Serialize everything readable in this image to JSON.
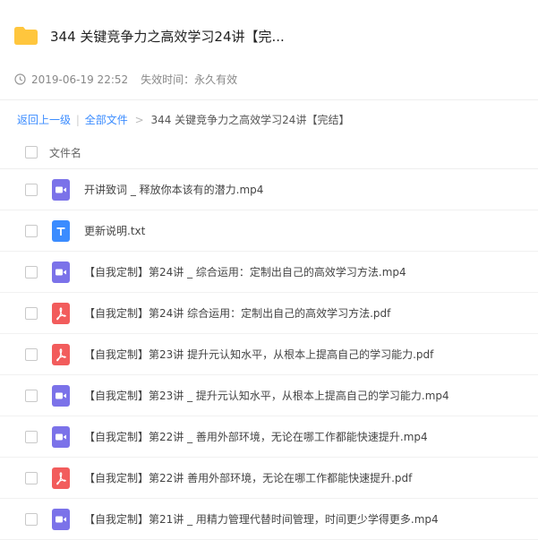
{
  "header": {
    "title": "344 关键竞争力之高效学习24讲【完...",
    "date": "2019-06-19 22:52",
    "expiry": "失效时间：永久有效"
  },
  "breadcrumb": {
    "back": "返回上一级",
    "divider": "|",
    "all": "全部文件",
    "arrow": ">",
    "current": "344 关键竞争力之高效学习24讲【完结】"
  },
  "list": {
    "header_label": "文件名",
    "files": [
      {
        "name": "开讲致词 _ 释放你本该有的潜力.mp4",
        "icon": "video-icon"
      },
      {
        "name": "更新说明.txt",
        "icon": "text-icon"
      },
      {
        "name": "【自我定制】第24讲 _ 综合运用：定制出自己的高效学习方法.mp4",
        "icon": "video-icon"
      },
      {
        "name": "【自我定制】第24讲 综合运用：定制出自己的高效学习方法.pdf",
        "icon": "pdf-icon"
      },
      {
        "name": "【自我定制】第23讲 提升元认知水平，从根本上提高自己的学习能力.pdf",
        "icon": "pdf-icon"
      },
      {
        "name": "【自我定制】第23讲 _ 提升元认知水平，从根本上提高自己的学习能力.mp4",
        "icon": "video-icon"
      },
      {
        "name": "【自我定制】第22讲 _ 善用外部环境，无论在哪工作都能快速提升.mp4",
        "icon": "video-icon"
      },
      {
        "name": "【自我定制】第22讲 善用外部环境，无论在哪工作都能快速提升.pdf",
        "icon": "pdf-icon"
      },
      {
        "name": "【自我定制】第21讲 _ 用精力管理代替时间管理，时间更少学得更多.mp4",
        "icon": "video-icon"
      }
    ]
  },
  "colors": {
    "folder": "#ffc63d",
    "video": "#7b72e9",
    "text": "#3b8cff",
    "pdf": "#f25c5c",
    "link": "#3b8cff"
  }
}
